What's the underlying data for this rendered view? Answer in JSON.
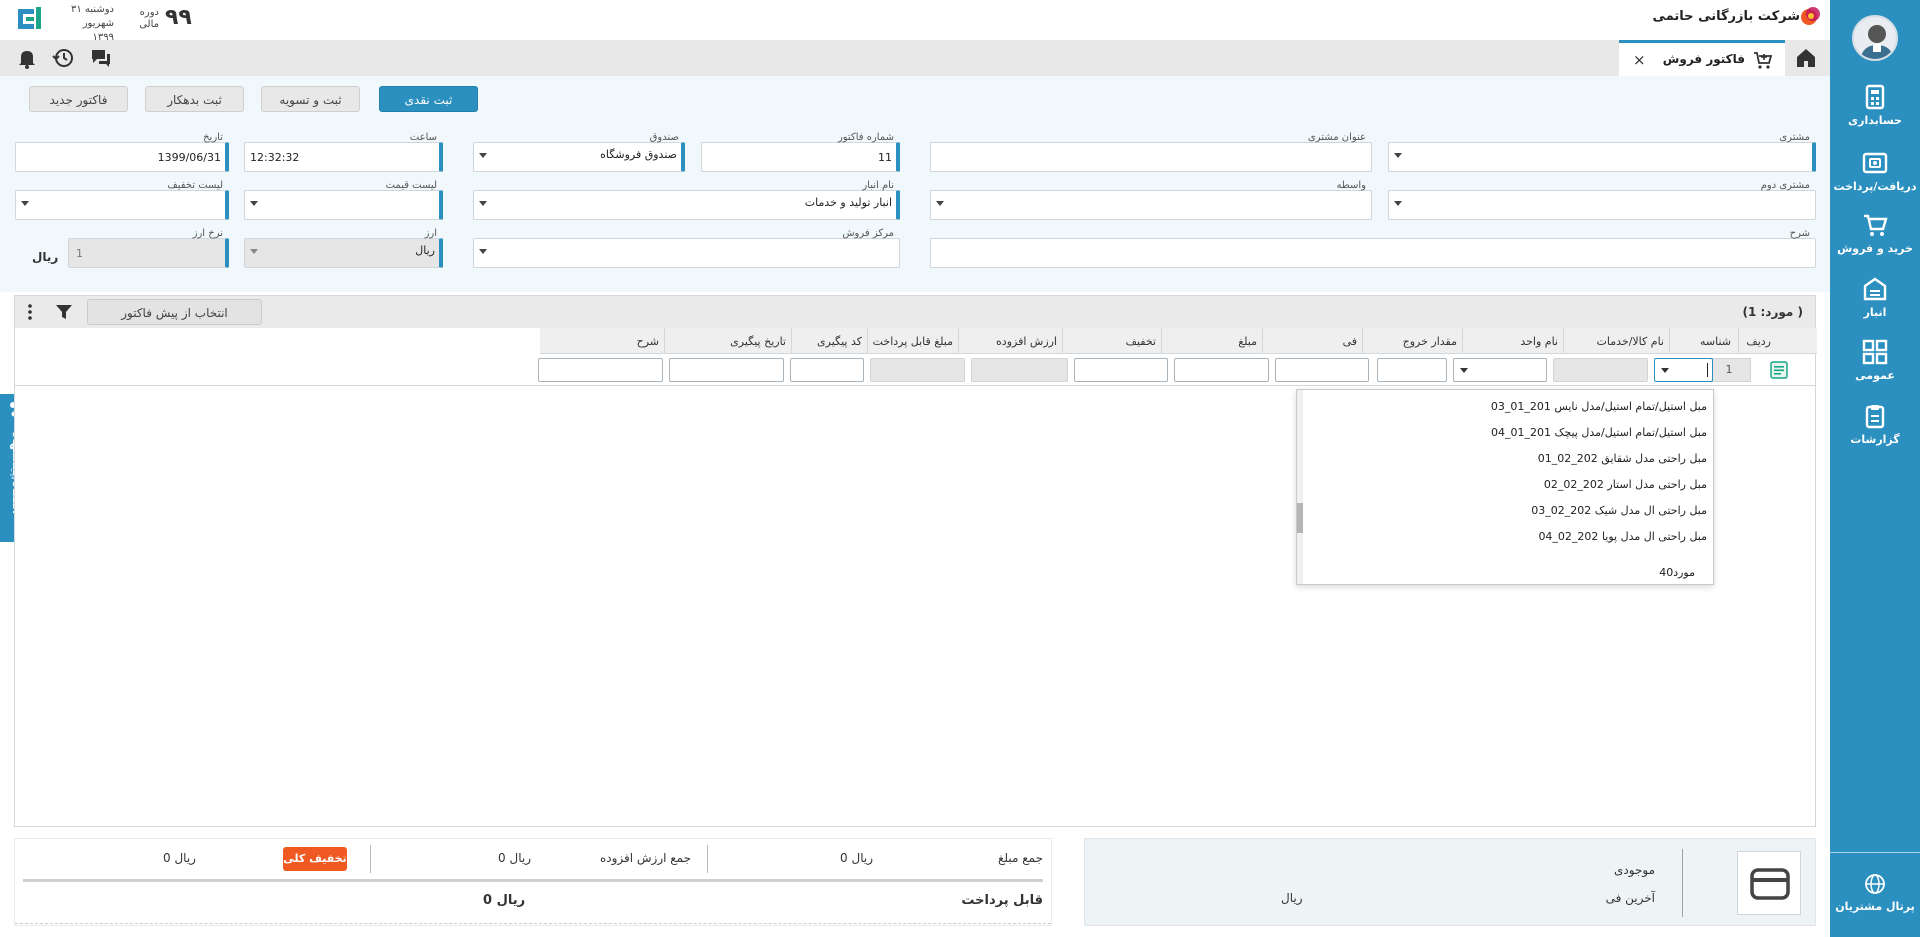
{
  "sidebar": {
    "items": [
      {
        "label": "حسابداری",
        "icon": "accounting-icon"
      },
      {
        "label": "دریافت/پرداخت",
        "icon": "cash-icon"
      },
      {
        "label": "خرید و فروش",
        "icon": "cart-icon"
      },
      {
        "label": "انبار",
        "icon": "warehouse-icon"
      },
      {
        "label": "عمومی",
        "icon": "modules-icon"
      },
      {
        "label": "گزارشات",
        "icon": "reports-icon"
      }
    ],
    "portal": "پرتال مشتریان"
  },
  "topbar": {
    "company": "شرکت بازرگانی حاتمی",
    "period_value": "۹۹",
    "period_label_1": "دوره",
    "period_label_2": "مالی",
    "day": "دوشنبه ۳۱",
    "month": "شهریور ۱۳۹۹"
  },
  "tabs": {
    "active": "فاکتور فروش",
    "close": "×"
  },
  "actions": {
    "cash": "ثبت نقدی",
    "settle": "ثبت و تسویه",
    "debit": "ثبت بدهکار",
    "new": "فاکتور جدید"
  },
  "feedback": "انتقاد/پیشنهاد",
  "form": {
    "customer": {
      "label": "مشتری",
      "value": ""
    },
    "customer_title": {
      "label": "عنوان مشتری",
      "value": ""
    },
    "invoice_no": {
      "label": "شماره فاکتور",
      "value": "11"
    },
    "cashbox": {
      "label": "صندوق",
      "value": "صندوق فروشگاه"
    },
    "time": {
      "label": "ساعت",
      "value": "12:32:32"
    },
    "date": {
      "label": "تاریخ",
      "value": "1399/06/31"
    },
    "second_customer": {
      "label": "مشتری دوم",
      "value": ""
    },
    "broker": {
      "label": "واسطه",
      "value": ""
    },
    "warehouse": {
      "label": "نام انبار",
      "value": "انبار تولید و خدمات"
    },
    "price_list": {
      "label": "لیست قیمت",
      "value": ""
    },
    "discount_list": {
      "label": "لیست تخفیف",
      "value": ""
    },
    "description": {
      "label": "شرح",
      "value": ""
    },
    "sales_center": {
      "label": "مرکز فروش",
      "value": ""
    },
    "currency": {
      "label": "ارز",
      "value": "ریال"
    },
    "rate": {
      "label": "نرخ ارز",
      "value": "1"
    },
    "rate_unit": "ریال"
  },
  "grid": {
    "count": "(مورد: 1 )",
    "preinvoice": "انتخاب از پیش فاکتور",
    "headers": [
      "ردیف",
      "شناسه",
      "نام کالا/خدمات",
      "نام واحد",
      "مقدار خروج",
      "فی",
      "مبلغ",
      "تخفیف",
      "ارزش افزوده",
      "مبلغ قابل پرداخت",
      "کد پیگیری",
      "تاریخ پیگیری",
      "شرح"
    ],
    "row_number": "1"
  },
  "dropdown": {
    "items": [
      "03_01_201 مبل استیل/تمام استیل/مدل نایس",
      "04_01_201 مبل استیل/تمام استیل/مدل پیچک",
      "01_02_202 مبل راحتی مدل شقایق",
      "02_02_202 مبل راحتی مدل استار",
      "03_02_202 مبل راحتی ال مدل شیک",
      "04_02_202 مبل راحتی ال مدل پویا"
    ],
    "count": "40مورد"
  },
  "footer": {
    "sum_label": "جمع مبلغ",
    "sum_value": "0 ریال",
    "vat_label": "جمع ارزش افزوده",
    "vat_value": "0 ریال",
    "discount_btn": "تخفیف کلی",
    "discount_value": "0 ریال",
    "payable_label": "قابل پرداخت",
    "payable_value": "0 ریال",
    "stock_label": "موجودی",
    "last_price_label": "آخرین فی",
    "last_price_unit": "ریال"
  },
  "colors": {
    "primary": "#2b8fbf",
    "accent": "#f05a22"
  }
}
